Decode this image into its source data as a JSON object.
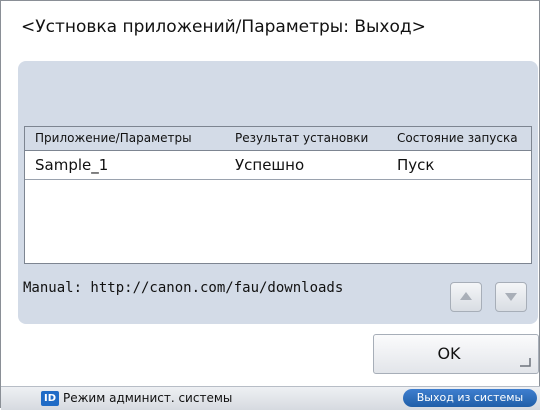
{
  "screen": {
    "title": "<Устновка приложений/Параметры: Выход>"
  },
  "table": {
    "columns": [
      "Приложение/Параметры",
      "Результат установки",
      "Состояние запуска"
    ],
    "rows": [
      {
        "name": "Sample_1",
        "result": "Успешно",
        "state": "Пуск"
      }
    ]
  },
  "manual": {
    "text": "Manual: http://canon.com/fau/downloads"
  },
  "scroll": {
    "up_icon": "triangle-up-icon",
    "down_icon": "triangle-down-icon",
    "disabled_color": "#a9afb8"
  },
  "ok_button": {
    "label": "OK"
  },
  "status_bar": {
    "id_badge": "ID",
    "admin_mode": "Режим админист. системы",
    "logout": "Выход из системы",
    "accent": "#1f6bc6"
  }
}
